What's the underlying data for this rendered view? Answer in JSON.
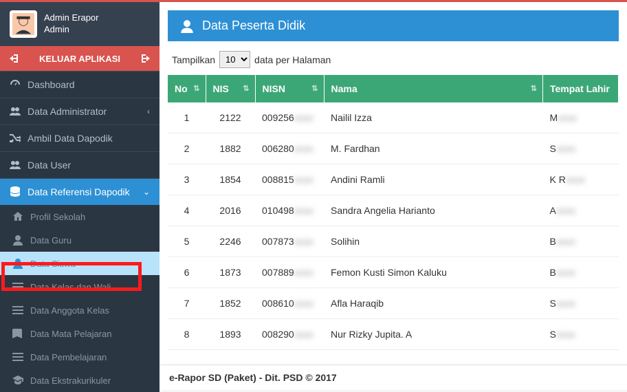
{
  "user": {
    "name": "Admin Erapor",
    "role": "Admin"
  },
  "logout": {
    "label": "KELUAR APLIKASI"
  },
  "nav": {
    "dashboard": "Dashboard",
    "data_admin": "Data Administrator",
    "ambil_dapodik": "Ambil Data Dapodik",
    "data_user": "Data User",
    "referensi": "Data Referensi Dapodik",
    "sub": {
      "profil": "Profil Sekolah",
      "guru": "Data Guru",
      "siswa": "Data Siswa",
      "kelas": "Data Kelas dan Wali",
      "anggota": "Data Anggota Kelas",
      "mapel": "Data Mata Pelajaran",
      "pembelajaran": "Data Pembelajaran",
      "ekskul": "Data Ekstrakurikuler"
    }
  },
  "panel": {
    "title": "Data Peserta Didik"
  },
  "pager": {
    "prefix": "Tampilkan",
    "suffix": "data per Halaman",
    "value": "10"
  },
  "columns": {
    "no": "No",
    "nis": "NIS",
    "nisn": "NISN",
    "nama": "Nama",
    "tempat": "Tempat Lahir"
  },
  "rows": [
    {
      "no": "1",
      "nis": "2122",
      "nisn": "009256",
      "nama": "Nailil Izza",
      "tempat": "M"
    },
    {
      "no": "2",
      "nis": "1882",
      "nisn": "006280",
      "nama": "M. Fardhan",
      "tempat": "S"
    },
    {
      "no": "3",
      "nis": "1854",
      "nisn": "008815",
      "nama": "Andini Ramli",
      "tempat": "K           R"
    },
    {
      "no": "4",
      "nis": "2016",
      "nisn": "010498",
      "nama": "Sandra Angelia Harianto",
      "tempat": "A"
    },
    {
      "no": "5",
      "nis": "2246",
      "nisn": "007873",
      "nama": "Solihin",
      "tempat": "B"
    },
    {
      "no": "6",
      "nis": "1873",
      "nisn": "007889",
      "nama": "Femon Kusti Simon Kaluku",
      "tempat": "B"
    },
    {
      "no": "7",
      "nis": "1852",
      "nisn": "008610",
      "nama": "Afla Haraqib",
      "tempat": "S"
    },
    {
      "no": "8",
      "nis": "1893",
      "nisn": "008290",
      "nama": "Nur Rizky Jupita. A",
      "tempat": "S"
    }
  ],
  "footer": {
    "text": "e-Rapor SD (Paket) - Dit. PSD © 2017"
  }
}
